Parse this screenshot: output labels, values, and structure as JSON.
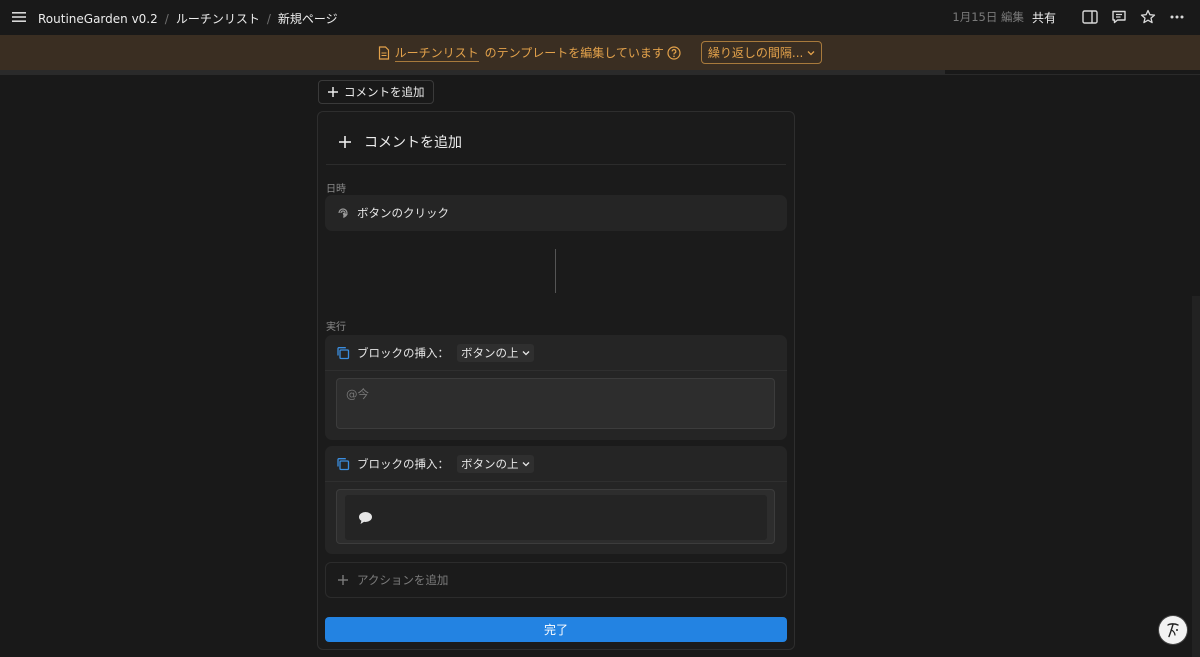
{
  "topbar": {
    "breadcrumbs": [
      "RoutineGarden v0.2",
      "ルーチンリスト",
      "新規ページ"
    ],
    "separator": "/",
    "edited": "1月15日 編集",
    "share_label": "共有",
    "icons": [
      "menu-icon",
      "sidebar-panel-icon",
      "comment-icon",
      "star-icon",
      "more-icon"
    ]
  },
  "banner": {
    "template_link": "ルーチンリスト",
    "message": "のテンプレートを編集しています",
    "repeat_button": "繰り返しの間隔...",
    "accent_color": "#e3a24b",
    "background_color": "#3a2e22"
  },
  "add_comment_top": {
    "label": "コメントを追加"
  },
  "panel": {
    "header_label": "コメントを追加",
    "trigger_section_label": "日時",
    "trigger_label": "ボタンのクリック",
    "actions_section_label": "実行",
    "actions": [
      {
        "label": "ブロックの挿入：",
        "position": "ボタンの上",
        "content_placeholder": "@今"
      },
      {
        "label": "ブロックの挿入：",
        "position": "ボタンの上",
        "content_icon": "speech-bubble-icon"
      }
    ],
    "add_action_label": "アクションを追加",
    "done_label": "完了",
    "done_color": "#2383e2"
  }
}
